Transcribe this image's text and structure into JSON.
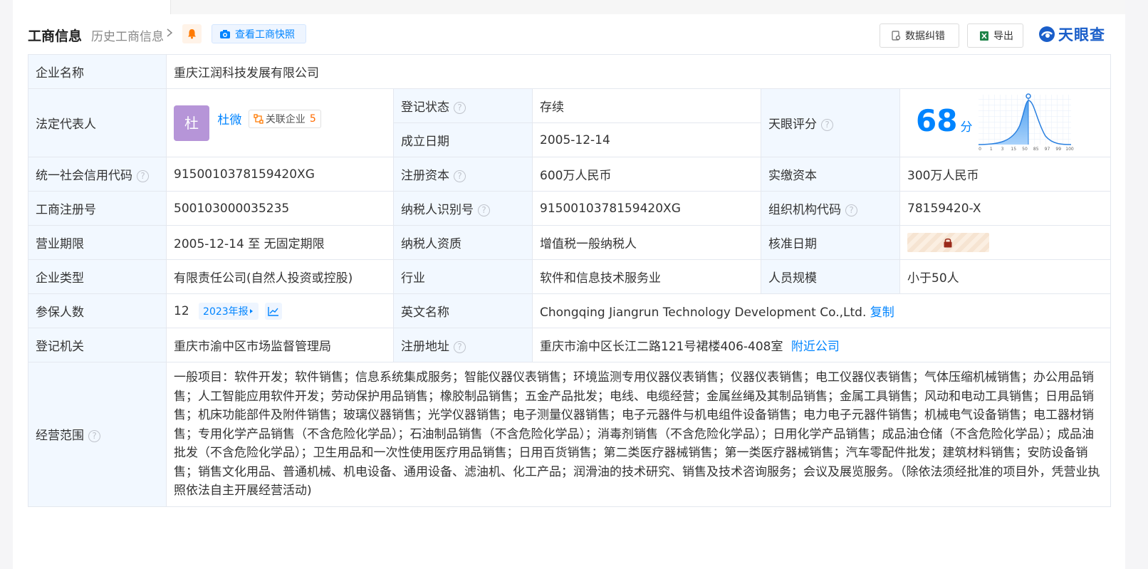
{
  "header": {
    "title": "工商信息",
    "history_link": "历史工商信息",
    "snapshot_button": "查看工商快照",
    "data_correction_button": "数据纠错",
    "export_button": "导出",
    "logo_text": "天眼查"
  },
  "rows": {
    "company_name_label": "企业名称",
    "company_name": "重庆江润科技发展有限公司",
    "legal_rep_label": "法定代表人",
    "legal_rep_avatar": "杜",
    "legal_rep_name": "杜微",
    "related_company_label": "关联企业",
    "related_company_count": "5",
    "reg_status_label": "登记状态",
    "reg_status": "存续",
    "established_label": "成立日期",
    "established": "2005-12-14",
    "tianyan_score_label": "天眼评分",
    "score": "68",
    "score_unit": "分",
    "credit_code_label": "统一社会信用代码",
    "credit_code": "9150010378159420XG",
    "reg_capital_label": "注册资本",
    "reg_capital": "600万人民币",
    "paid_capital_label": "实缴资本",
    "paid_capital": "300万人民币",
    "biz_reg_no_label": "工商注册号",
    "biz_reg_no": "500103000035235",
    "taxpayer_id_label": "纳税人识别号",
    "taxpayer_id": "9150010378159420XG",
    "org_code_label": "组织机构代码",
    "org_code": "78159420-X",
    "biz_term_label": "营业期限",
    "biz_term": "2005-12-14 至 无固定期限",
    "taxpayer_qual_label": "纳税人资质",
    "taxpayer_qual": "增值税一般纳税人",
    "approval_date_label": "核准日期",
    "company_type_label": "企业类型",
    "company_type": "有限责任公司(自然人投资或控股)",
    "industry_label": "行业",
    "industry": "软件和信息技术服务业",
    "staff_size_label": "人员规模",
    "staff_size": "小于50人",
    "insured_label": "参保人数",
    "insured": "12",
    "annual_report_button": "2023年报",
    "english_name_label": "英文名称",
    "english_name": "Chongqing Jiangrun Technology Development Co.,Ltd.",
    "copy_link": "复制",
    "reg_authority_label": "登记机关",
    "reg_authority": "重庆市渝中区市场监督管理局",
    "reg_address_label": "注册地址",
    "reg_address": "重庆市渝中区长江二路121号裙楼406-408室",
    "nearby_link": "附近公司",
    "scope_label": "经营范围",
    "scope": "一般项目：软件开发；软件销售；信息系统集成服务；智能仪器仪表销售；环境监测专用仪器仪表销售；仪器仪表销售；电工仪器仪表销售；气体压缩机械销售；办公用品销售；人工智能应用软件开发；劳动保护用品销售；橡胶制品销售；五金产品批发；电线、电缆经营；金属丝绳及其制品销售；金属工具销售；风动和电动工具销售；日用品销售；机床功能部件及附件销售；玻璃仪器销售；光学仪器销售；电子测量仪器销售；电子元器件与机电组件设备销售；电力电子元器件销售；机械电气设备销售；电工器材销售；专用化学产品销售（不含危险化学品）；石油制品销售（不含危险化学品）；消毒剂销售（不含危险化学品）；日用化学产品销售；成品油仓储（不含危险化学品）；成品油批发（不含危险化学品）；卫生用品和一次性使用医疗用品销售；日用百货销售；第二类医疗器械销售；第一类医疗器械销售；汽车零配件批发；建筑材料销售；安防设备销售；销售文化用品、普通机械、机电设备、通用设备、滤油机、化工产品；润滑油的技术研究、销售及技术咨询服务；会议及展览服务。（除依法须经批准的项目外，凭营业执照依法自主开展经营活动)"
  },
  "score_chart": {
    "x_ticks": [
      "0",
      "1",
      "3",
      "15",
      "50",
      "85",
      "97",
      "99",
      "100"
    ]
  },
  "colors": {
    "accent": "#0084ff",
    "status_green": "#0c9c40",
    "label_bg": "#f2f8ff"
  }
}
